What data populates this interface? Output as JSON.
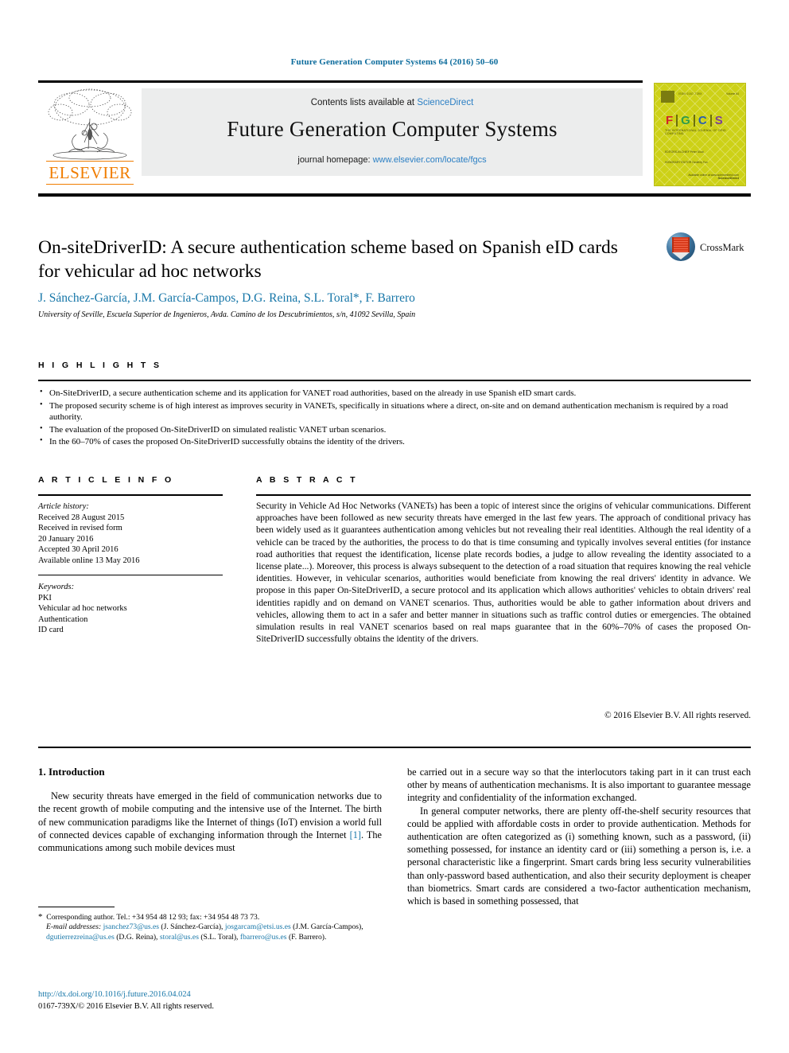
{
  "running_head": "Future Generation Computer Systems 64 (2016) 50–60",
  "masthead": {
    "contents_prefix": "Contents lists available at ",
    "sciencedirect": "ScienceDirect",
    "journal_name": "Future Generation Computer Systems",
    "homepage_prefix": "journal homepage: ",
    "homepage_url": "www.elsevier.com/locate/fgcs",
    "publisher": "ELSEVIER"
  },
  "cover": {
    "issn_line": "ISSN 0167-739X",
    "volume_line": "Volume 64",
    "letters": [
      "F",
      "G",
      "C",
      "S"
    ],
    "subtitle": "THE INTERNATIONAL JOURNAL OF GRID COMPUTING",
    "block1": "EDITORS-IN-CHIEF\nPeter Sloot",
    "block2": "HONORARY EDITOR\nGeoffrey Fox",
    "foot1": "Available online at www.sciencedirect.com",
    "foot2": "ScienceDirect"
  },
  "article": {
    "title": "On-siteDriverID: A secure authentication scheme based on Spanish eID cards for vehicular ad hoc networks",
    "authors": "J. Sánchez-García, J.M. García-Campos, D.G. Reina, S.L. Toral*, F. Barrero",
    "affiliation": "University of Seville, Escuela Superior de Ingenieros, Avda. Camino de los Descubrimientos, s/n, 41092 Sevilla, Spain",
    "crossmark_label": "CrossMark"
  },
  "highlights": {
    "label": "H I G H L I G H T S",
    "items": [
      "On-SiteDriverID, a secure authentication scheme and its application for VANET road authorities, based on the already in use Spanish eID smart cards.",
      "The proposed security scheme is of high interest as improves security in VANETs, specifically in situations where a direct, on-site and on demand authentication mechanism is required by a road authority.",
      "The evaluation of the proposed On-SiteDriverID on simulated realistic VANET urban scenarios.",
      "In the 60–70% of cases the proposed On-SiteDriverID successfully obtains the identity of the drivers."
    ]
  },
  "article_info": {
    "label": "A R T I C L E   I N F O",
    "history_label": "Article history:",
    "history": [
      "Received 28 August 2015",
      "Received in revised form",
      "20 January 2016",
      "Accepted 30 April 2016",
      "Available online 13 May 2016"
    ],
    "keywords_label": "Keywords:",
    "keywords": [
      "PKI",
      "Vehicular ad hoc networks",
      "Authentication",
      "ID card"
    ]
  },
  "abstract": {
    "label": "A B S T R A C T",
    "text": "Security in Vehicle Ad Hoc Networks (VANETs) has been a topic of interest since the origins of vehicular communications. Different approaches have been followed as new security threats have emerged in the last few years. The approach of conditional privacy has been widely used as it guarantees authentication among vehicles but not revealing their real identities. Although the real identity of a vehicle can be traced by the authorities, the process to do that is time consuming and typically involves several entities (for instance road authorities that request the identification, license plate records bodies, a judge to allow revealing the identity associated to a license plate...). Moreover, this process is always subsequent to the detection of a road situation that requires knowing the real vehicle identities. However, in vehicular scenarios, authorities would beneficiate from knowing the real drivers' identity in advance. We propose in this paper On-SiteDriverID, a secure protocol and its application which allows authorities' vehicles to obtain drivers' real identities rapidly and on demand on VANET scenarios. Thus, authorities would be able to gather information about drivers and vehicles, allowing them to act in a safer and better manner in situations such as traffic control duties or emergencies. The obtained simulation results in real VANET scenarios based on real maps guarantee that in the 60%–70% of cases the proposed On-SiteDriverID successfully obtains the identity of the drivers.",
    "copyright": "© 2016 Elsevier B.V. All rights reserved."
  },
  "body": {
    "section_title": "1. Introduction",
    "left_p1_a": "New security threats have emerged in the field of communication networks due to the recent growth of mobile computing and the intensive use of the Internet. The birth of new communication paradigms like the Internet of things (IoT) envision a world full of connected devices capable of exchanging information through the Internet ",
    "left_cite": "[1]",
    "left_p1_b": ". The communications among such mobile devices must",
    "right_p1": "be carried out in a secure way so that the interlocutors taking part in it can trust each other by means of authentication mechanisms. It is also important to guarantee message integrity and confidentiality of the information exchanged.",
    "right_p2": "In general computer networks, there are plenty off-the-shelf security resources that could be applied with affordable costs in order to provide authentication. Methods for authentication are often categorized as (i) something known, such as a password, (ii) something possessed, for instance an identity card or (iii) something a person is, i.e. a personal characteristic like a fingerprint. Smart cards bring less security vulnerabilities than only-password based authentication, and also their security deployment is cheaper than biometrics. Smart cards are considered a two-factor authentication mechanism, which is based in something possessed, that"
  },
  "footnote": {
    "corresponding": "Corresponding author. Tel.: +34 954 48 12 93; fax: +34 954 48 73 73.",
    "email_label": "E-mail addresses:",
    "emails": [
      {
        "address": "jsanchez73@us.es",
        "name": "(J. Sánchez-García),"
      },
      {
        "address": "josgarcam@etsi.us.es",
        "name": "(J.M. García-Campos),"
      },
      {
        "address": "dgutierrezreina@us.es",
        "name": "(D.G. Reina),"
      },
      {
        "address": "storal@us.es",
        "name": "(S.L. Toral),"
      },
      {
        "address": "fbarrero@us.es",
        "name": "(F. Barrero)."
      }
    ],
    "doi": "http://dx.doi.org/10.1016/j.future.2016.04.024",
    "issn": "0167-739X/© 2016 Elsevier B.V. All rights reserved."
  },
  "colors": {
    "link": "#1676a8",
    "sciencedirect": "#2b7fc4",
    "elsevier_orange": "#f07d00",
    "cover_bg": "#cdd116"
  }
}
